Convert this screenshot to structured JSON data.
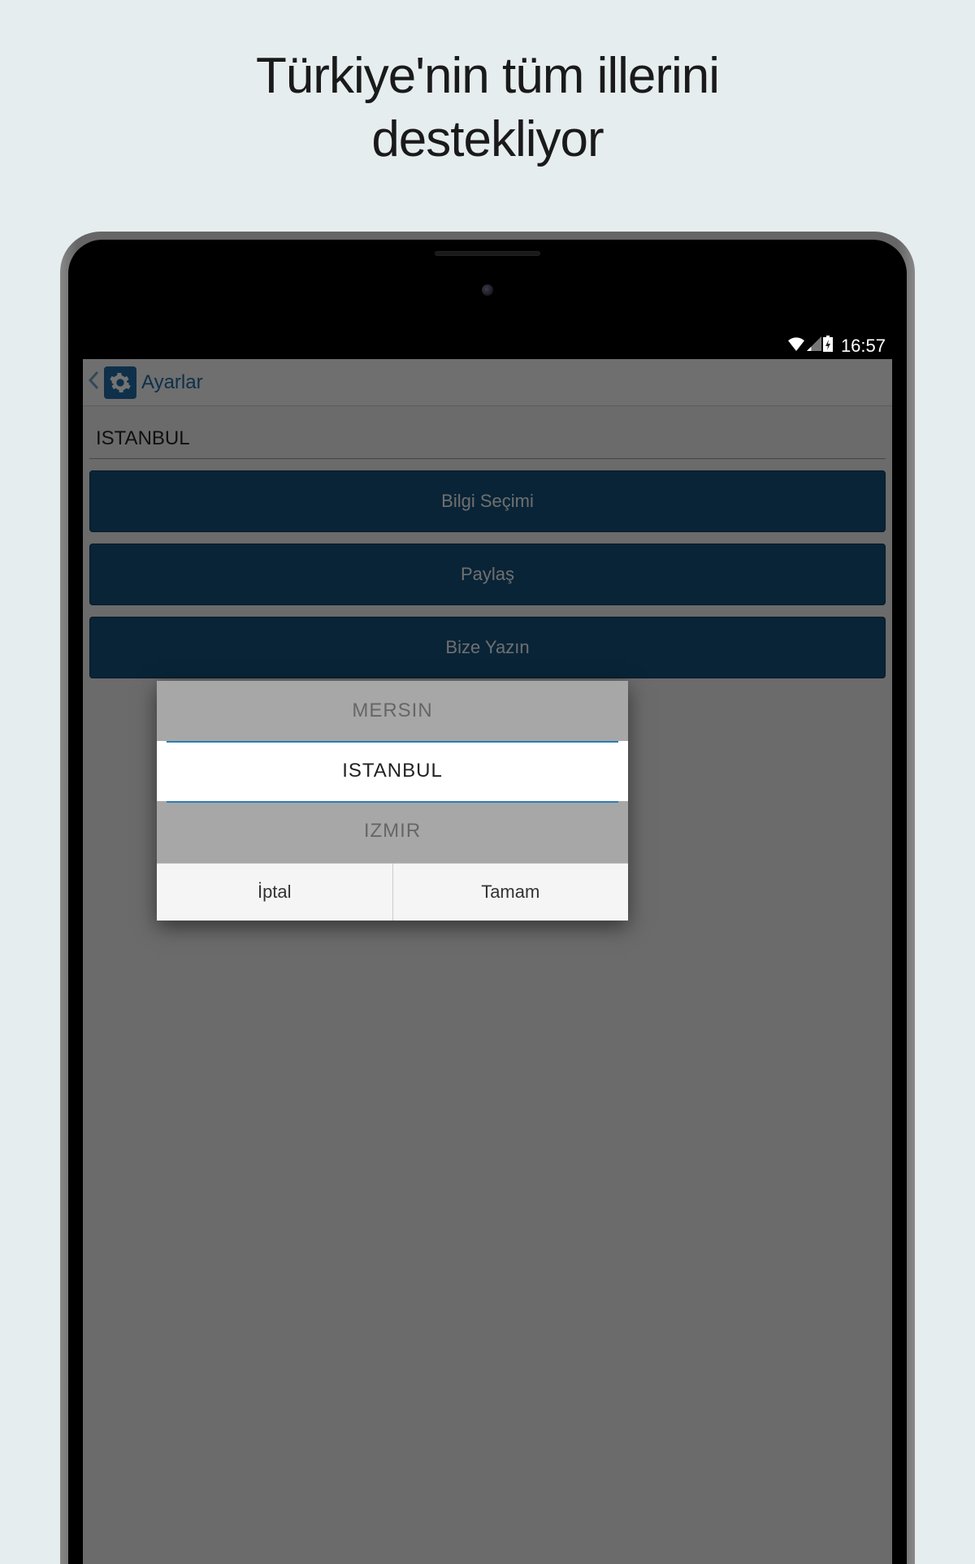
{
  "promo": {
    "line1": "Türkiye'nin tüm illerini",
    "line2": "destekliyor"
  },
  "status": {
    "time": "16:57"
  },
  "actionbar": {
    "title": "Ayarlar"
  },
  "settings": {
    "selected_city": "ISTANBUL",
    "buttons": {
      "info": "Bilgi Seçimi",
      "share": "Paylaş",
      "contact": "Bize Yazın"
    }
  },
  "picker": {
    "prev": "MERSIN",
    "current": "ISTANBUL",
    "next": "IZMIR",
    "cancel": "İptal",
    "confirm": "Tamam"
  }
}
